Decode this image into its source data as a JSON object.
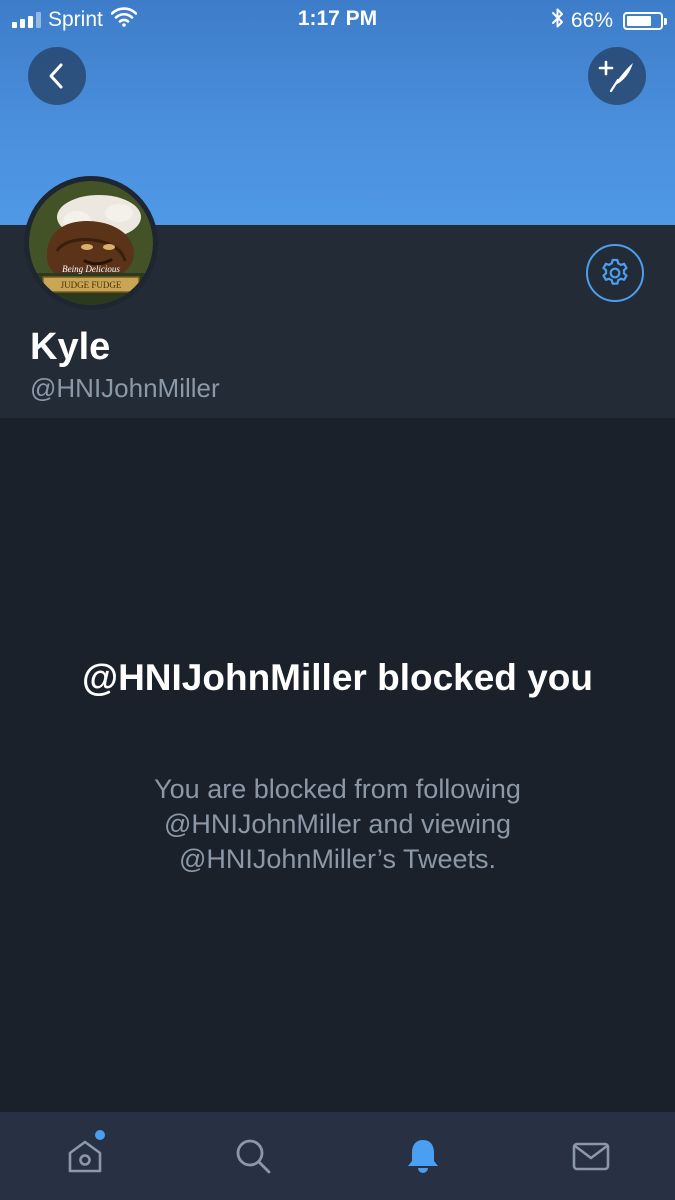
{
  "status_bar": {
    "carrier": "Sprint",
    "time": "1:17 PM",
    "battery_percent": "66%",
    "icons": [
      "signal-icon",
      "wifi-icon",
      "bluetooth-icon",
      "battery-icon"
    ]
  },
  "header": {
    "back_icon": "back-chevron-icon",
    "compose_icon": "compose-tweet-icon"
  },
  "profile": {
    "avatar_text_top": "Being Delicious",
    "avatar_text_plate": "JUDGE FUDGE",
    "name": "Kyle",
    "handle": "@HNIJohnMiller",
    "settings_icon": "gear-icon"
  },
  "blocked": {
    "title": "@HNIJohnMiller blocked you",
    "description": "You are blocked from following @HNIJohnMiller and viewing @HNIJohnMiller’s Tweets."
  },
  "tab_bar": {
    "tabs": [
      {
        "name": "home",
        "icon": "home-icon",
        "has_badge_dot": true
      },
      {
        "name": "search",
        "icon": "search-icon"
      },
      {
        "name": "notifications",
        "icon": "bell-icon",
        "active": true
      },
      {
        "name": "messages",
        "icon": "mail-icon"
      }
    ]
  },
  "colors": {
    "accent": "#4a9ff0",
    "banner": "#4a8fdc",
    "background": "#1b212a",
    "profile_bg": "#232b37",
    "secondary_text": "#8b98a8"
  }
}
